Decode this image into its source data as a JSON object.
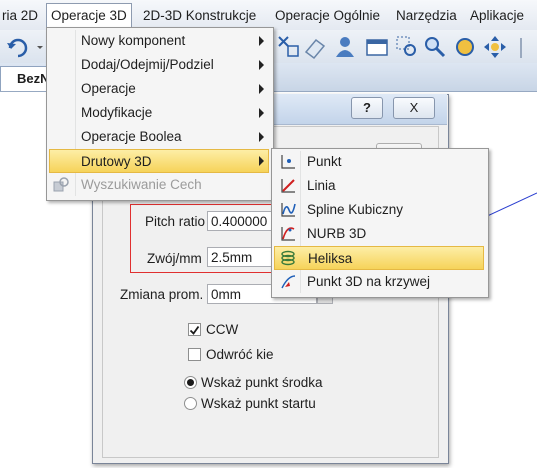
{
  "menubar": {
    "items": [
      "ria 2D",
      "Operacje 3D",
      "2D-3D Konstrukcje",
      "Operacje Ogólnie",
      "Narzędzia",
      "Aplikacje"
    ],
    "active_index": 1
  },
  "document_tab": {
    "label": "BezN"
  },
  "dialog": {
    "help_label": "?",
    "close_label": "X",
    "pitch_ratio": {
      "label": "Pitch ratio",
      "value": "0.400000"
    },
    "turn": {
      "label": "Zwój/mm",
      "value": "2.5mm"
    },
    "radius_change": {
      "label": "Zmiana prom.",
      "value": "0mm"
    },
    "ccw": {
      "label": "CCW",
      "checked": true
    },
    "reverse": {
      "label": "Odwróć kie",
      "checked": false
    },
    "center_point": {
      "label": "Wskaż punkt środka",
      "selected": true
    },
    "start_point": {
      "label": "Wskaż punkt startu",
      "selected": false
    }
  },
  "operacje_menu": {
    "items": [
      {
        "label": "Nowy komponent",
        "submenu": true,
        "enabled": true
      },
      {
        "label": "Dodaj/Odejmij/Podziel",
        "submenu": true,
        "enabled": true
      },
      {
        "label": "Operacje",
        "submenu": true,
        "enabled": true
      },
      {
        "label": "Modyfikacje",
        "submenu": true,
        "enabled": true
      },
      {
        "label": "Operacje Boolea",
        "submenu": true,
        "enabled": true
      },
      {
        "label": "Drutowy 3D",
        "submenu": true,
        "enabled": true,
        "highlighted": true
      },
      {
        "label": "Wyszukiwanie Cech",
        "submenu": false,
        "enabled": false,
        "icon": "feature-search-icon"
      }
    ]
  },
  "wire_menu": {
    "items": [
      {
        "label": "Punkt",
        "icon": "point-icon"
      },
      {
        "label": "Linia",
        "icon": "line-icon"
      },
      {
        "label": "Spline Kubiczny",
        "icon": "spline-icon"
      },
      {
        "label": "NURB 3D",
        "icon": "nurb-icon"
      },
      {
        "label": "Heliksa",
        "icon": "helix-icon",
        "highlighted": true
      },
      {
        "label": "Punkt 3D na krzywej",
        "icon": "point-on-curve-icon"
      }
    ]
  },
  "colors": {
    "highlight": "#f6d35a",
    "accent": "#1f5fb8",
    "annotation": "#e03030"
  }
}
